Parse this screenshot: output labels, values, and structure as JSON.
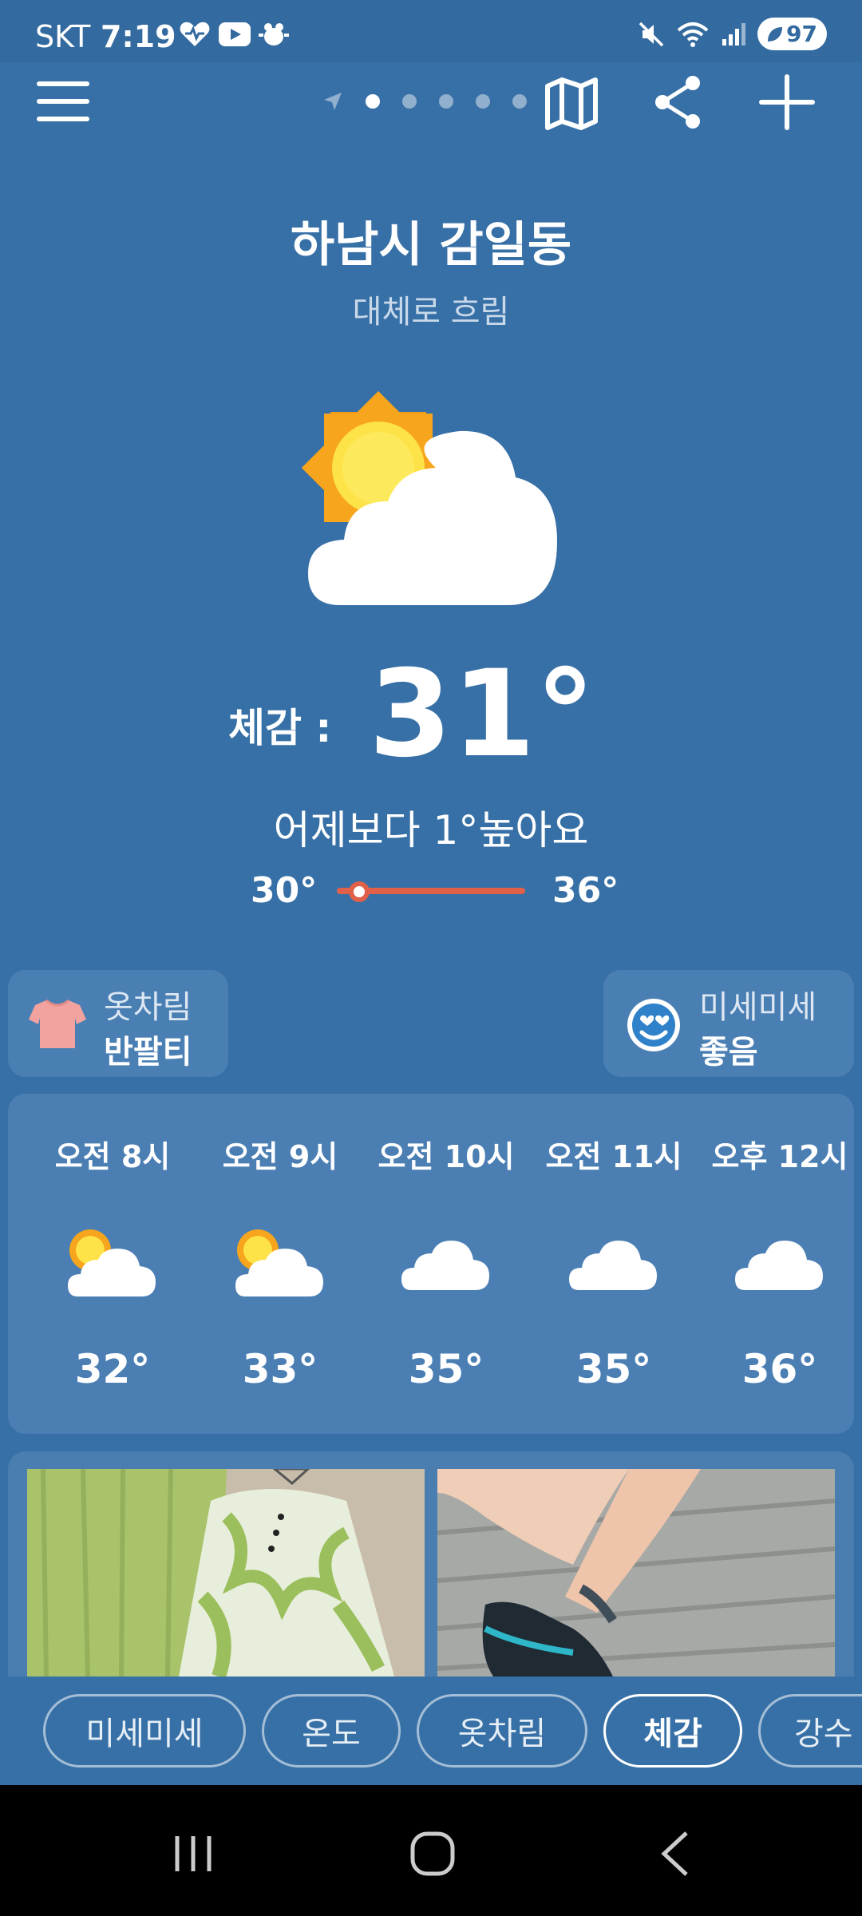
{
  "status_bar": {
    "carrier": "SKT",
    "time": "7:19",
    "battery": "97"
  },
  "top_bar": {
    "page_dots": 5,
    "active_page": 0
  },
  "location": {
    "name": "하남시 감일동",
    "condition": "대체로 흐림"
  },
  "current": {
    "feels_label": "체감 :",
    "feels_temp": "31°",
    "compare": "어제보다 1°높아요",
    "min": "30°",
    "max": "36°",
    "current_fraction": 0.12
  },
  "chips": {
    "clothes": {
      "title": "옷차림",
      "value": "반팔티"
    },
    "dust": {
      "title": "미세미세",
      "value": "좋음"
    }
  },
  "hourly": [
    {
      "time": "오전 8시",
      "icon": "partly-cloudy-icon",
      "temp": "32°"
    },
    {
      "time": "오전 9시",
      "icon": "partly-cloudy-icon",
      "temp": "33°"
    },
    {
      "time": "오전 10시",
      "icon": "cloud-icon",
      "temp": "35°"
    },
    {
      "time": "오전 11시",
      "icon": "cloud-icon",
      "temp": "35°"
    },
    {
      "time": "오후 12시",
      "icon": "cloud-icon",
      "temp": "36°"
    }
  ],
  "tabs": [
    {
      "label": "미세미세",
      "active": false
    },
    {
      "label": "온도",
      "active": false
    },
    {
      "label": "옷차림",
      "active": false
    },
    {
      "label": "체감",
      "active": true
    },
    {
      "label": "강수",
      "active": false
    }
  ],
  "colors": {
    "background": "#3770a6",
    "card": "#4b7fb3",
    "accent": "#e0604a"
  }
}
